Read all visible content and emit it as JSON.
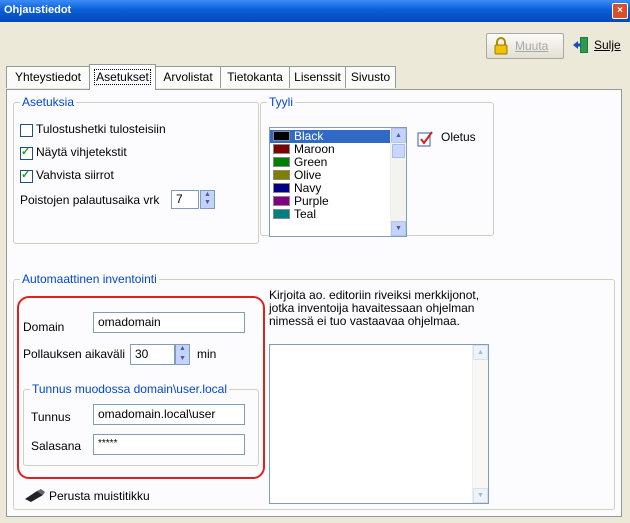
{
  "window": {
    "title": "Ohjaustiedot",
    "close_glyph": "×"
  },
  "toolbar": {
    "edit_label": "Muuta",
    "close_label": "Sulje"
  },
  "tabs": [
    {
      "label": "Yhteystiedot"
    },
    {
      "label": "Asetukset"
    },
    {
      "label": "Arvolistat"
    },
    {
      "label": "Tietokanta"
    },
    {
      "label": "Lisenssit"
    },
    {
      "label": "Sivusto"
    }
  ],
  "settings": {
    "title": "Asetuksia",
    "print_timestamp": {
      "label": "Tulostushetki tulosteisiin",
      "checked": false
    },
    "show_tooltips": {
      "label": "Näytä vihjetekstit",
      "checked": true
    },
    "confirm_transfers": {
      "label": "Vahvista siirrot",
      "checked": true
    },
    "undo_weeks": {
      "label": "Poistojen palautusaika vrk",
      "value": "7"
    }
  },
  "style": {
    "title": "Tyyli",
    "default_label": "Oletus",
    "colors": [
      {
        "name": "Black",
        "hex": "#000000",
        "selected": true
      },
      {
        "name": "Maroon",
        "hex": "#800000"
      },
      {
        "name": "Green",
        "hex": "#008000"
      },
      {
        "name": "Olive",
        "hex": "#808000"
      },
      {
        "name": "Navy",
        "hex": "#000080"
      },
      {
        "name": "Purple",
        "hex": "#800080"
      },
      {
        "name": "Teal",
        "hex": "#008080"
      }
    ]
  },
  "inventory": {
    "title": "Automaattinen inventointi",
    "domain": {
      "label": "Domain",
      "value": "omadomain"
    },
    "poll": {
      "label": "Pollauksen aikaväli",
      "value": "30",
      "unit": "min"
    },
    "credentials": {
      "title": "Tunnus muodossa domain\\user.local",
      "user": {
        "label": "Tunnus",
        "value": "omadomain.local\\user"
      },
      "password": {
        "label": "Salasana",
        "value": "*****"
      }
    },
    "instructions": "Kirjoita ao. editoriin riveiksi merkkijonot, jotka inventoija havaitessaan ohjelman nimessä ei tuo vastaavaa ohjelmaa.",
    "note_button": "Perusta muistitikku"
  }
}
